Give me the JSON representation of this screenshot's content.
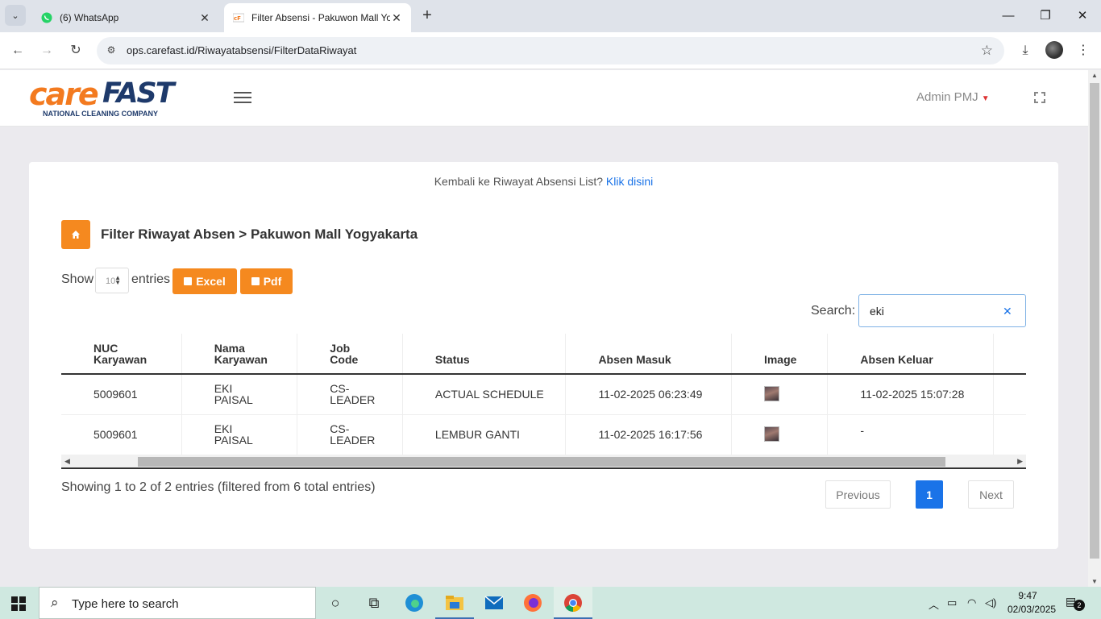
{
  "browser": {
    "tabs": [
      {
        "title": "(6) WhatsApp",
        "favicon": "whatsapp-icon",
        "active": false
      },
      {
        "title": "Filter Absensi - Pakuwon Mall Yo",
        "favicon": "carefast-favicon",
        "active": true
      }
    ],
    "url": "ops.carefast.id/Riwayatabsensi/FilterDataRiwayat"
  },
  "header": {
    "logo_care": "care",
    "logo_fast": "FAST",
    "logo_tagline": "NATIONAL CLEANING COMPANY",
    "user": "Admin PMJ"
  },
  "card": {
    "back_text": "Kembali ke Riwayat Absensi List?",
    "back_link": "Klik disini",
    "title": "Filter Riwayat Absen > Pakuwon Mall Yogyakarta",
    "show_label": "Show",
    "show_value": "10",
    "entries_label": "entries",
    "excel_label": "Excel",
    "pdf_label": "Pdf",
    "search_label": "Search:",
    "search_value": "eki",
    "columns": [
      [
        "NUC",
        "Karyawan"
      ],
      [
        "Nama",
        "Karyawan"
      ],
      [
        "Job",
        "Code"
      ],
      [
        "Status"
      ],
      [
        "Absen Masuk"
      ],
      [
        "Image"
      ],
      [
        "Absen Keluar"
      ]
    ],
    "rows": [
      {
        "nuc": "5009601",
        "nama": [
          "EKI",
          "PAISAL"
        ],
        "job": [
          "CS-",
          "LEADER"
        ],
        "status": "ACTUAL SCHEDULE",
        "masuk": "11-02-2025 06:23:49",
        "keluar": "11-02-2025 15:07:28"
      },
      {
        "nuc": "5009601",
        "nama": [
          "EKI",
          "PAISAL"
        ],
        "job": [
          "CS-",
          "LEADER"
        ],
        "status": "LEMBUR GANTI",
        "masuk": "11-02-2025 16:17:56",
        "keluar": "-"
      }
    ],
    "info": "Showing 1 to 2 of 2 entries (filtered from 6 total entries)",
    "pagination": {
      "previous": "Previous",
      "current": "1",
      "next": "Next"
    }
  },
  "taskbar": {
    "search_placeholder": "Type here to search",
    "time": "9:47",
    "date": "02/03/2025",
    "notifications": "2"
  }
}
